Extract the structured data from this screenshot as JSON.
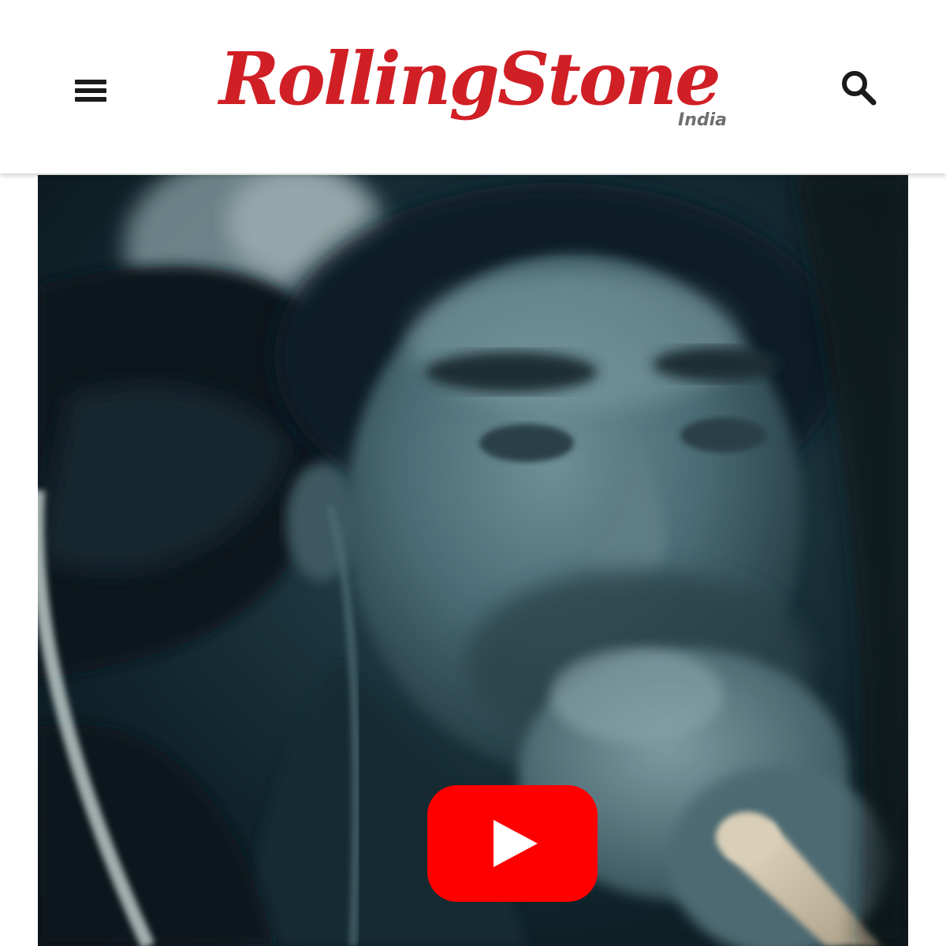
{
  "header": {
    "brand_name": "RollingStone",
    "brand_edition": "India",
    "menu_icon": "hamburger-menu-icon",
    "search_icon": "search-icon",
    "brand_color": "#d11f26"
  },
  "video": {
    "player": "youtube",
    "play_icon": "play-icon",
    "play_button_color": "#ff0000"
  }
}
